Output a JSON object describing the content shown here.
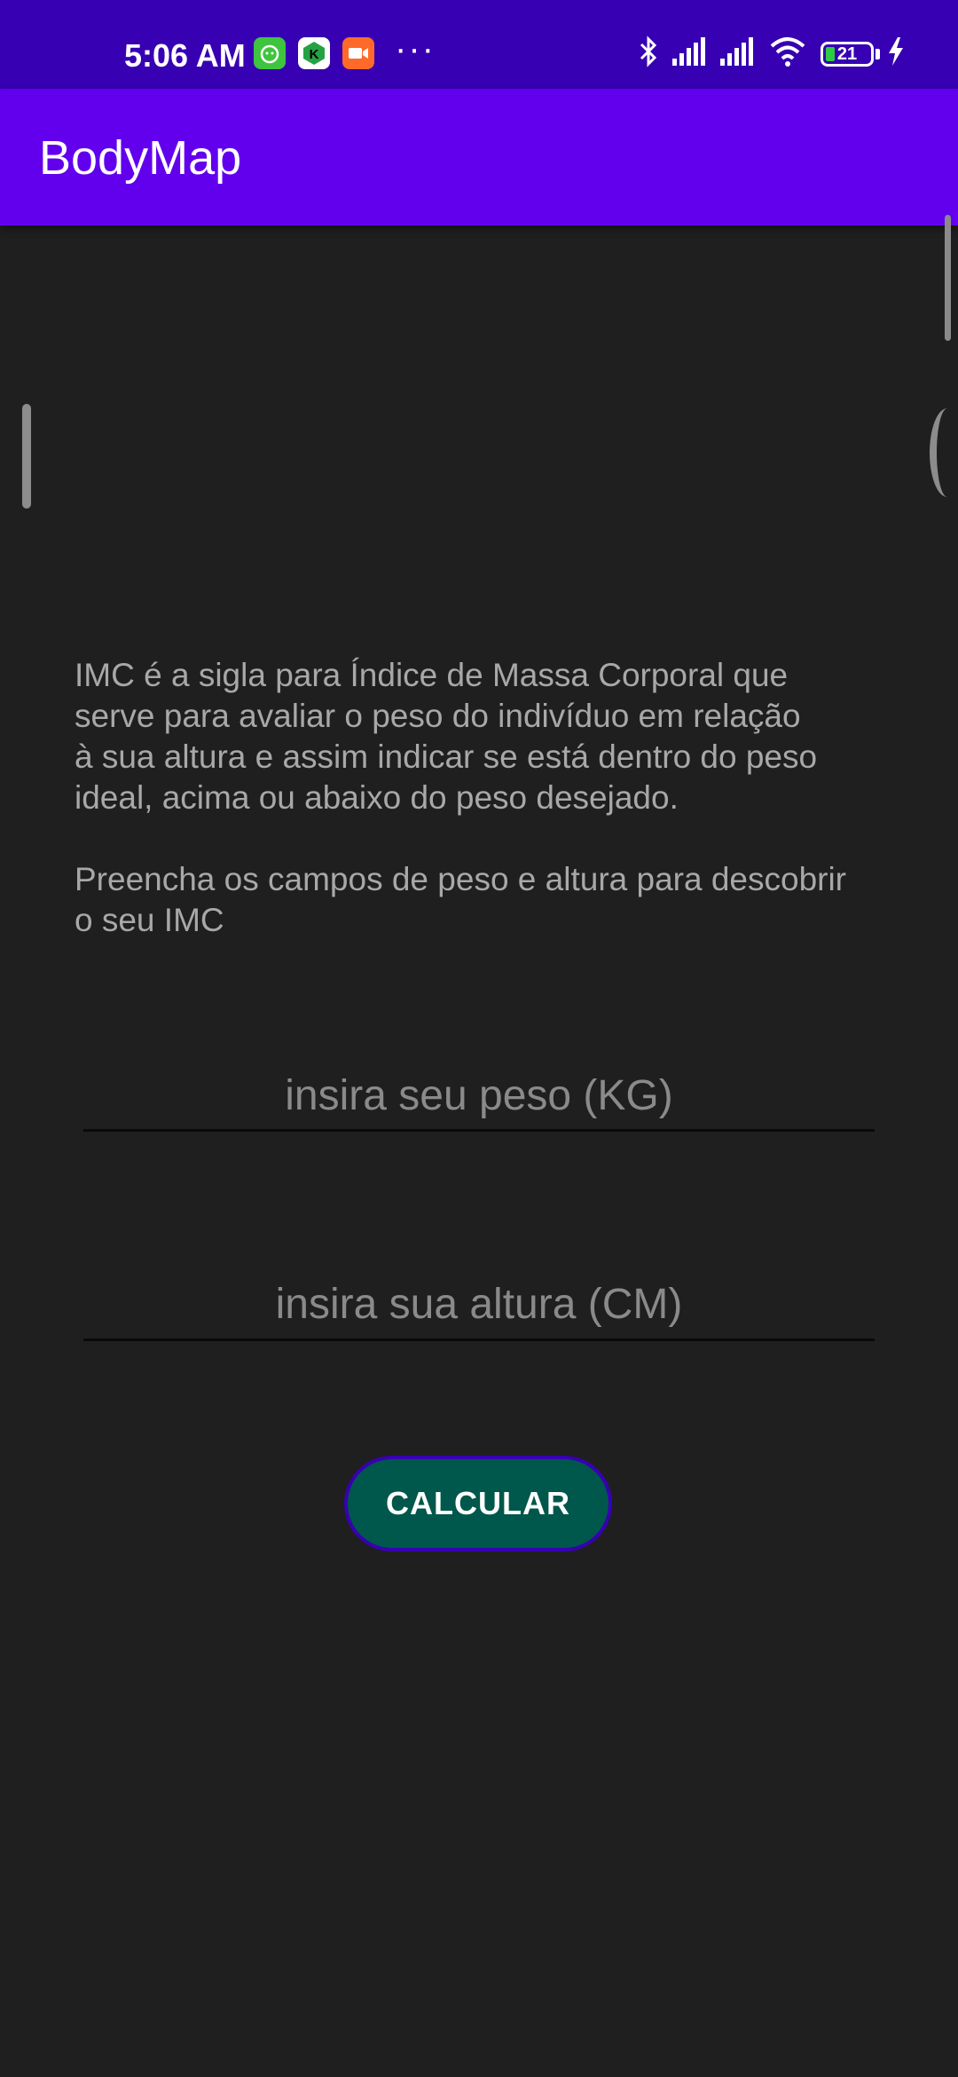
{
  "status_bar": {
    "time": "5:06 AM",
    "battery_level": "21",
    "notification_icons": [
      "cat-app-icon",
      "k-app-icon",
      "video-call-icon"
    ],
    "right_icons": [
      "bluetooth-icon",
      "cell-signal-icon",
      "cell-signal-icon",
      "wifi-icon",
      "battery-icon",
      "charging-icon"
    ],
    "more_indicator": "···"
  },
  "app_bar": {
    "title": "BodyMap"
  },
  "main": {
    "description_paragraph_1": "IMC é a sigla para Índice de Massa Corporal que\nserve para avaliar o peso do indivíduo em relação\nà sua altura e assim indicar se está dentro do peso\nideal, acima ou abaixo do peso desejado.",
    "description_paragraph_2": "Preencha os campos de peso e altura para descobrir\no seu IMC",
    "weight_input": {
      "placeholder": "insira seu peso (KG)",
      "value": ""
    },
    "height_input": {
      "placeholder": "insira sua altura (CM)",
      "value": ""
    },
    "calculate_button": "CALCULAR"
  },
  "colors": {
    "status_bar": "#3700b3",
    "app_bar": "#6200ee",
    "background": "#1f1f1f",
    "button": "#00574b",
    "button_border": "#3700b3"
  }
}
